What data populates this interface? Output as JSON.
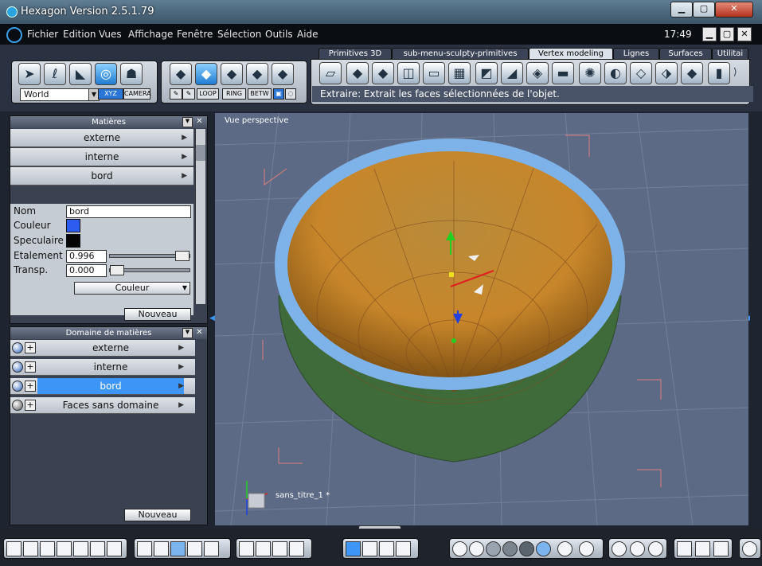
{
  "window": {
    "title": "Hexagon Version 2.5.1.79",
    "close_label": "✕",
    "minimize_label": "▁",
    "maximize_label": "▢"
  },
  "menubar": {
    "items": [
      "Fichier",
      "Edition",
      "Vues",
      "Affichage",
      "Fenêtre",
      "Sélection",
      "Outils",
      "Aide"
    ],
    "clock": "17:49"
  },
  "toolbar": {
    "coordinate_system": "World",
    "xyz_label": "XYZ",
    "camera_label": "CAMERA",
    "sel_buttons": [
      "LOOP",
      "RING",
      "BETW"
    ],
    "tabs": [
      "Primitives 3D",
      "sub-menu-sculpty-primitives",
      "Vertex modeling",
      "Lignes",
      "Surfaces",
      "Utilitai"
    ],
    "active_tab": "Vertex modeling",
    "tooltip": "Extraire: Extrait les faces sélectionnées de l'objet."
  },
  "materials_panel": {
    "title": "Matières",
    "materials": [
      "externe",
      "interne",
      "bord"
    ],
    "properties": {
      "name_label": "Nom",
      "name_value": "bord",
      "color_label": "Couleur",
      "color_value": "#2f5cf0",
      "specular_label": "Speculaire",
      "specular_value": "#050505",
      "spread_label": "Etalement",
      "spread_value": "0.996",
      "transp_label": "Transp.",
      "transp_value": "0.000",
      "channel_select": "Couleur"
    },
    "new_button": "Nouveau"
  },
  "domains_panel": {
    "title": "Domaine de matières",
    "domains": [
      "externe",
      "interne",
      "bord",
      "Faces sans domaine"
    ],
    "selected": "bord",
    "new_button": "Nouveau"
  },
  "viewport": {
    "view_name": "Vue perspective",
    "document_name": "sans_titre_1 *"
  },
  "colors": {
    "accent": "#3d96f6",
    "viewport_bg": "#5c6a85",
    "rim": "#7db3e8",
    "bowl": "#c8862a"
  }
}
